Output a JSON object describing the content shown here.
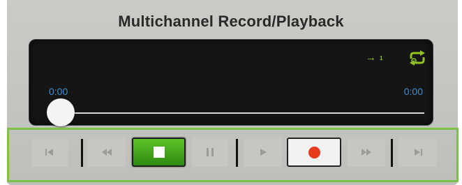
{
  "title": "Multichannel Record/Playback",
  "display": {
    "time_elapsed": "0:00",
    "time_total": "0:00",
    "routing_label": "1",
    "playhead_position": 0
  },
  "transport": {
    "buttons": [
      {
        "name": "skip-to-start",
        "icon": "skip-back-icon",
        "state": "disabled"
      },
      {
        "name": "rewind",
        "icon": "rewind-icon",
        "state": "disabled"
      },
      {
        "name": "stop",
        "icon": "stop-icon",
        "state": "active"
      },
      {
        "name": "pause",
        "icon": "pause-icon",
        "state": "disabled"
      },
      {
        "name": "play",
        "icon": "play-icon",
        "state": "disabled"
      },
      {
        "name": "record",
        "icon": "record-icon",
        "state": "enabled"
      },
      {
        "name": "fast-forward",
        "icon": "fast-forward-icon",
        "state": "disabled"
      },
      {
        "name": "skip-to-end",
        "icon": "skip-forward-icon",
        "state": "disabled"
      }
    ]
  },
  "colors": {
    "accent_green": "#8fc31f",
    "stop_active_green": "#4aaa1e",
    "record_red": "#e83a1c",
    "time_text_blue": "#3c8fd6",
    "transport_outline": "#7cc04a"
  }
}
